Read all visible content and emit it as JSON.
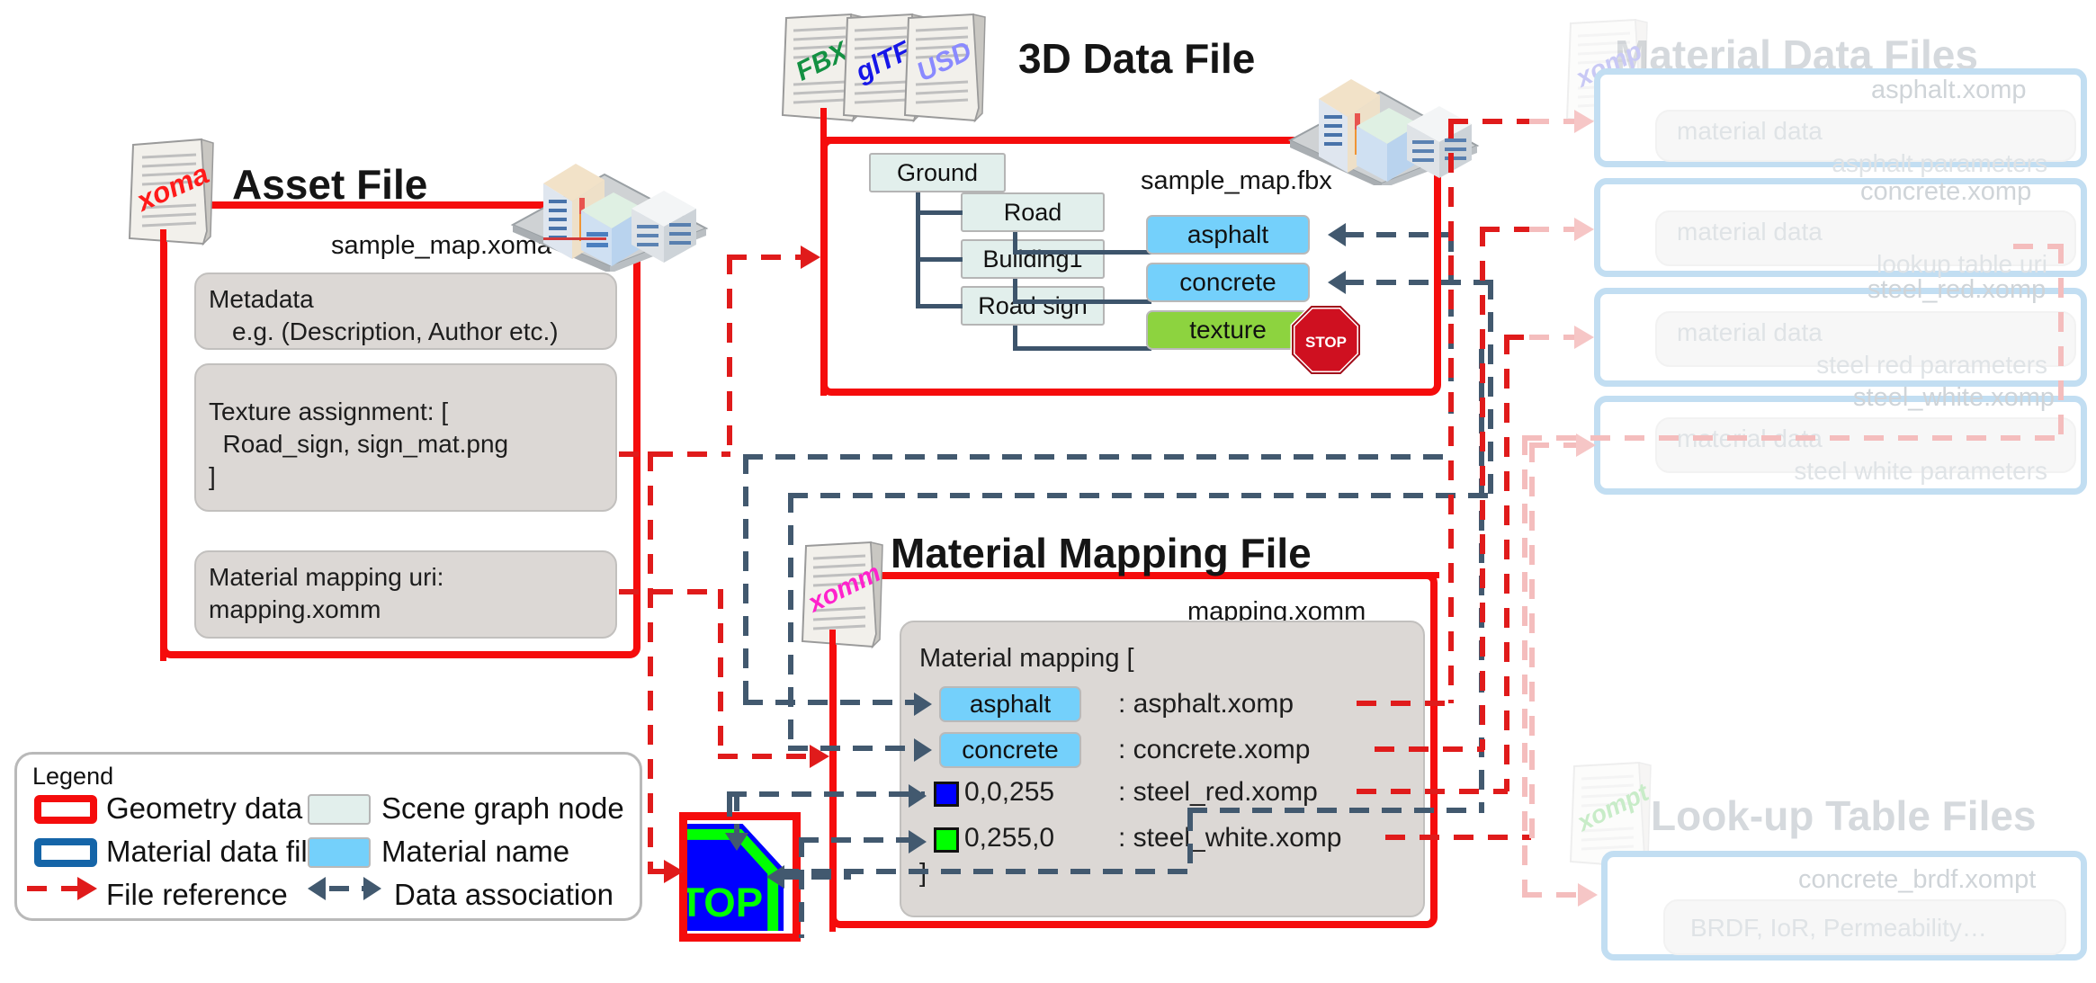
{
  "asset_file": {
    "title": "Asset File",
    "filename": "sample_map.xoma",
    "icon_ext": "xoma",
    "panels": [
      {
        "line1": "Metadata",
        "line2": "e.g. (Description, Author etc.)"
      },
      {
        "line1": "Texture assignment: [",
        "line2": "  Road_sign, sign_mat.png",
        "line3": "]"
      },
      {
        "line1": "Material mapping uri:",
        "line2": "mapping.xomm"
      }
    ]
  },
  "data_file": {
    "title": "3D Data File",
    "filename": "sample_map.fbx",
    "format_icons": [
      "FBX",
      "glTF",
      "USD"
    ],
    "scene_graph": {
      "root": "Ground",
      "children": [
        "Road",
        "Building1",
        "Road sign"
      ],
      "materials": [
        "asphalt",
        "concrete",
        "texture"
      ],
      "sign_badge": "STOP"
    }
  },
  "mapping_file": {
    "title": "Material Mapping File",
    "filename": "mapping.xomm",
    "icon_ext": "xomm",
    "header": "Material mapping [",
    "footer": "]",
    "rows": [
      {
        "key": "asphalt",
        "kind": "material",
        "value": ": asphalt.xomp"
      },
      {
        "key": "concrete",
        "kind": "material",
        "value": ": concrete.xomp"
      },
      {
        "key": "0,0,255",
        "kind": "color",
        "swatch": "#0000ff",
        "value": ": steel_red.xomp"
      },
      {
        "key": "0,255,0",
        "kind": "color",
        "swatch": "#00ff00",
        "value": ": steel_white.xomp"
      }
    ]
  },
  "texture_image": {
    "label": "STOP",
    "border_color": "#f50c0c",
    "fill_color": "#0000ff",
    "outline_color": "#00ff00"
  },
  "material_data_files": {
    "title": "Material Data Files",
    "icon_ext": "xomp",
    "files": [
      {
        "filename": "asphalt.xomp",
        "line1": "material data",
        "line2": "asphalt parameters"
      },
      {
        "filename": "concrete.xomp",
        "line1": "material data",
        "line2": "lookup table uri"
      },
      {
        "filename": "steel_red.xomp",
        "line1": "material data",
        "line2": "steel red parameters"
      },
      {
        "filename": "steel_white.xomp",
        "line1": "material data",
        "line2": "steel white parameters"
      }
    ]
  },
  "lookup_table_files": {
    "title": "Look-up Table Files",
    "icon_ext": "xompt",
    "files": [
      {
        "filename": "concrete_brdf.xompt",
        "line1": "BRDF, IoR, Permeability…"
      }
    ]
  },
  "legend": {
    "title": "Legend",
    "items": [
      {
        "label": "Geometry data file"
      },
      {
        "label": "Scene graph node"
      },
      {
        "label": "Material data file"
      },
      {
        "label": "Material name"
      },
      {
        "label": "File reference"
      },
      {
        "label": "Data association"
      }
    ]
  },
  "colors": {
    "geometry_red": "#f50c0c",
    "material_blue": "#1565a8",
    "node_green": "#e2efec",
    "material_name": "#74d0fb",
    "texture_green": "#8dd33f",
    "association_navy": "#42596f"
  }
}
